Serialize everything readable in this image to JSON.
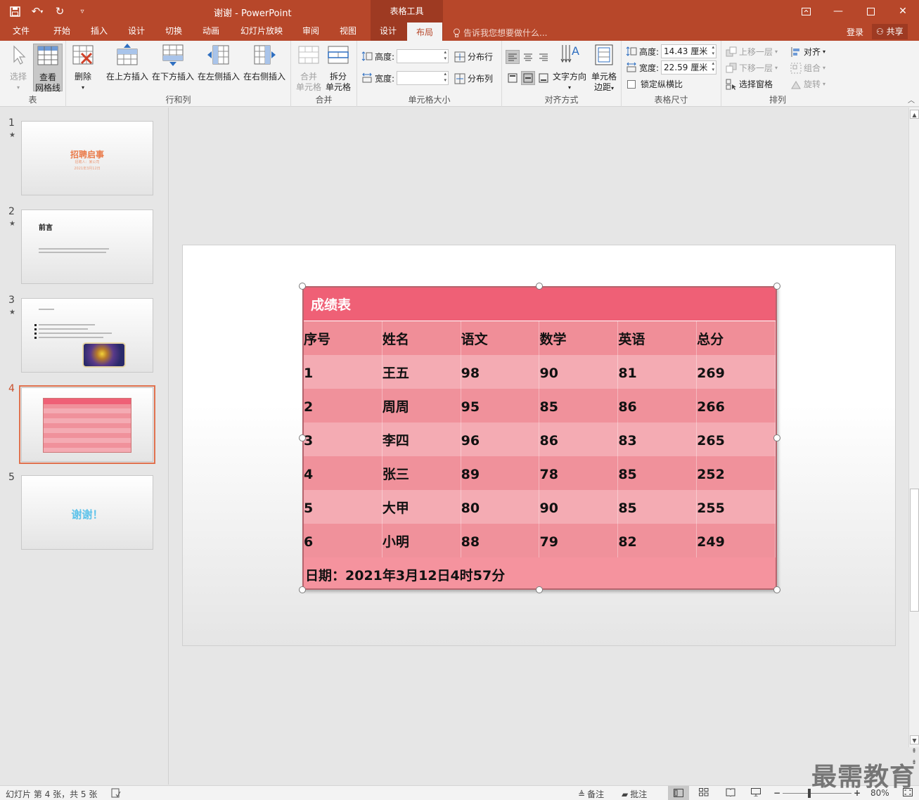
{
  "app": {
    "window_title": "谢谢 - PowerPoint",
    "context_tools": "表格工具",
    "tell_me": "告诉我您想要做什么...",
    "login": "登录",
    "share": "共享"
  },
  "tabs": [
    {
      "label": "文件"
    },
    {
      "label": "开始"
    },
    {
      "label": "插入"
    },
    {
      "label": "设计"
    },
    {
      "label": "切换"
    },
    {
      "label": "动画"
    },
    {
      "label": "幻灯片放映"
    },
    {
      "label": "审阅"
    },
    {
      "label": "视图"
    },
    {
      "label": "设计"
    },
    {
      "label": "布局"
    }
  ],
  "ribbon": {
    "group_table": {
      "label": "表",
      "select": "选择",
      "view_gridlines_1": "查看",
      "view_gridlines_2": "网格线"
    },
    "group_rows_cols": {
      "label": "行和列",
      "delete": "删除",
      "insert_above": "在上方插入",
      "insert_below": "在下方插入",
      "insert_left": "在左侧插入",
      "insert_right": "在右侧插入"
    },
    "group_merge": {
      "label": "合并",
      "merge_1": "合并",
      "merge_2": "单元格",
      "split_1": "拆分",
      "split_2": "单元格"
    },
    "group_cell_size": {
      "label": "单元格大小",
      "height_label": "高度:",
      "width_label": "宽度:",
      "height_value": "",
      "width_value": "",
      "distribute_rows": "分布行",
      "distribute_cols": "分布列"
    },
    "group_alignment": {
      "label": "对齐方式",
      "text_direction": "文字方向",
      "cell_margins_1": "单元格",
      "cell_margins_2": "边距"
    },
    "group_table_size": {
      "label": "表格尺寸",
      "height_label": "高度:",
      "height_value": "14.43 厘米",
      "width_label": "宽度:",
      "width_value": "22.59 厘米",
      "lock_ratio": "锁定纵横比"
    },
    "group_arrange": {
      "label": "排列",
      "bring_forward": "上移一层",
      "send_backward": "下移一层",
      "selection_pane": "选择窗格",
      "align": "对齐",
      "group": "组合",
      "rotate": "旋转"
    }
  },
  "thumbnails": [
    {
      "num": "1",
      "star": "★",
      "title": "招聘启事",
      "sub1": "招聘人：某公司",
      "sub2": "2021年3月12日"
    },
    {
      "num": "2",
      "star": "★",
      "title": "前言"
    },
    {
      "num": "3",
      "star": "★"
    },
    {
      "num": "4"
    },
    {
      "num": "5",
      "title": "谢谢！"
    }
  ],
  "slide_table": {
    "title": "成绩表",
    "headers": [
      "序号",
      "姓名",
      "语文",
      "数学",
      "英语",
      "总分"
    ],
    "rows": [
      [
        "1",
        "王五",
        "98",
        "90",
        "81",
        "269"
      ],
      [
        "2",
        "周周",
        "95",
        "85",
        "86",
        "266"
      ],
      [
        "3",
        "李四",
        "96",
        "86",
        "83",
        "265"
      ],
      [
        "4",
        "张三",
        "89",
        "78",
        "85",
        "252"
      ],
      [
        "5",
        "大甲",
        "80",
        "90",
        "85",
        "255"
      ],
      [
        "6",
        "小明",
        "88",
        "79",
        "82",
        "249"
      ]
    ],
    "footer": "日期：2021年3月12日4时57分"
  },
  "status": {
    "slide_info": "幻灯片 第 4 张，共 5 张",
    "notes": "备注",
    "comments": "批注",
    "zoom": "80%"
  },
  "watermark": "最需教育",
  "colors": {
    "accent": "#b7472a",
    "table_title": "#ef6076",
    "table_header": "#f08e98",
    "table_row_light": "#f4abb3",
    "table_row_dark": "#f0919b"
  }
}
